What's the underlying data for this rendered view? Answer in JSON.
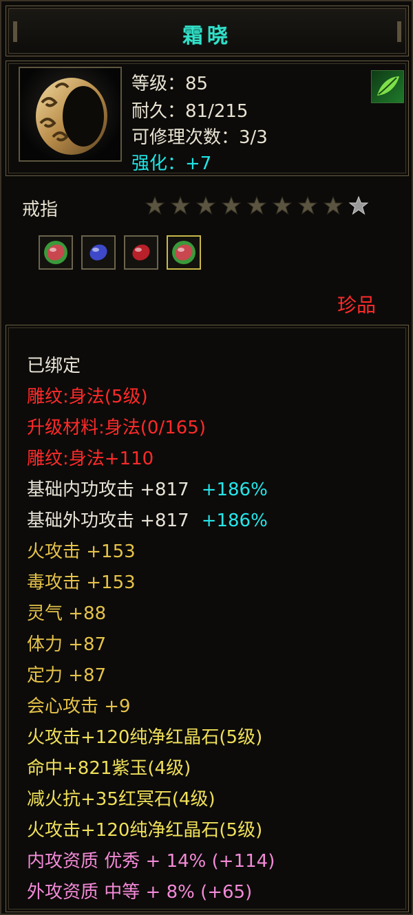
{
  "title": "霜晓",
  "item": {
    "level": "等级：85",
    "durability": "耐久：81/215",
    "repairs": "可修理次数：3/3",
    "enhance": "强化：+7",
    "type": "戒指",
    "stars_filled": 8,
    "stars_total": 9,
    "quality": "珍品"
  },
  "gems": [
    {
      "name": "green-red-gem-icon",
      "color": "#c9474f"
    },
    {
      "name": "blue-gem-icon",
      "color": "#3d49c9"
    },
    {
      "name": "red-gem-icon",
      "color": "#b8202a"
    },
    {
      "name": "green-red-gem-icon",
      "color": "#c9474f"
    }
  ],
  "props": {
    "bound": "已绑定",
    "engrave1": "雕纹:身法(5级)",
    "upgrade": "升级材料:身法(0/165)",
    "engrave2": "雕纹:身法+110",
    "inner_attack": "基础内功攻击  +817",
    "inner_attack_pct": "+186%",
    "outer_attack": "基础外功攻击  +817",
    "outer_attack_pct": "+186%",
    "fire": "火攻击  +153",
    "poison": "毒攻击  +153",
    "spirit": "灵气  +88",
    "stamina": "体力  +87",
    "focus": "定力  +87",
    "crit": "会心攻击  +9",
    "gem1": "火攻击+120纯净红晶石(5级)",
    "gem2": "命中+821紫玉(4级)",
    "gem3": "减火抗+35红冥石(4级)",
    "gem4": "火攻击+120纯净红晶石(5级)",
    "inner_quality": "内攻资质  优秀  + 14% (+114)",
    "outer_quality": "外攻资质  中等  + 8% (+65)"
  }
}
